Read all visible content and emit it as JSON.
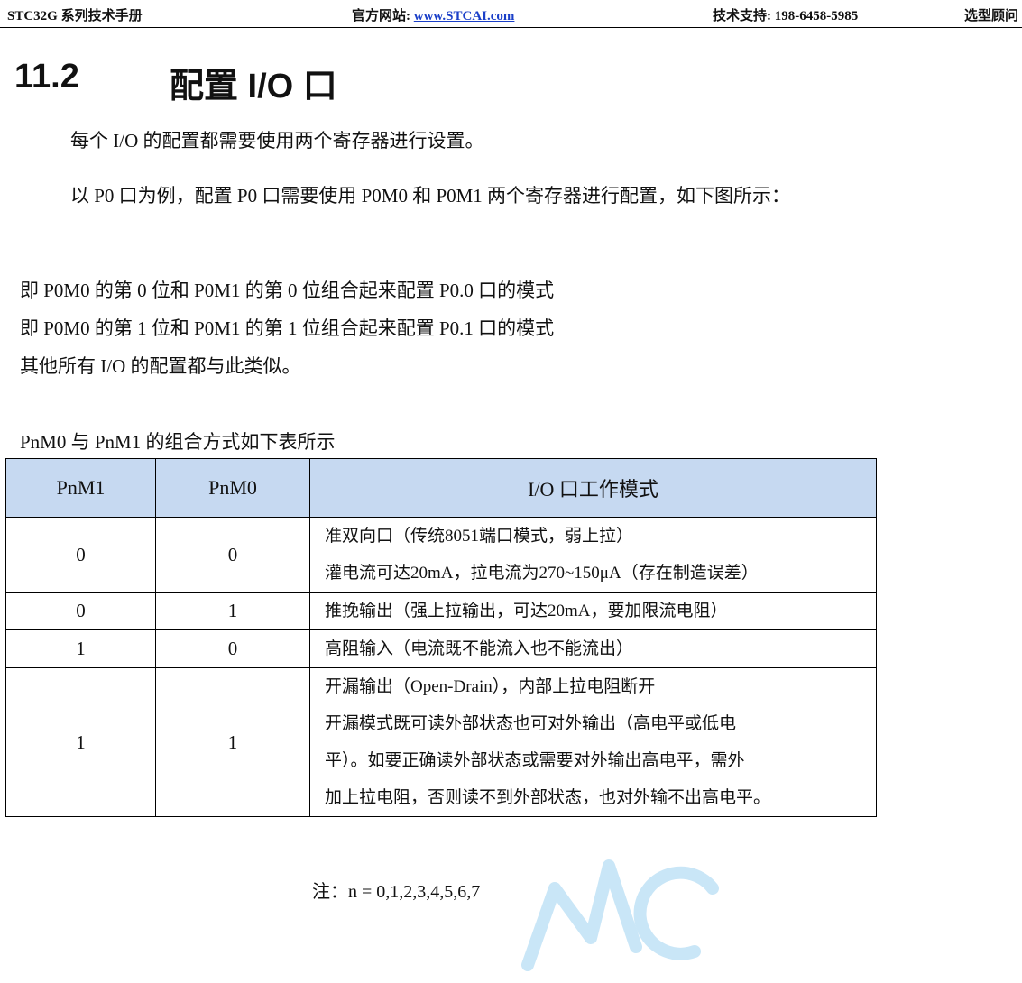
{
  "header": {
    "manual": "STC32G 系列技术手册",
    "site_label": "官方网站: ",
    "site_url": "www.STCAI.com",
    "support": "技术支持: 198-6458-5985",
    "selection": "选型顾问"
  },
  "section": {
    "number": "11.2",
    "title": "配置 I/O 口"
  },
  "paragraphs": {
    "p1": "每个 I/O 的配置都需要使用两个寄存器进行设置。",
    "p2": "以 P0 口为例，配置 P0 口需要使用 P0M0 和 P0M1 两个寄存器进行配置，如下图所示：",
    "p3": "即 P0M0 的第 0 位和 P0M1 的第 0 位组合起来配置 P0.0 口的模式",
    "p4": "即 P0M0 的第 1 位和 P0M1 的第 1 位组合起来配置 P0.1 口的模式",
    "p5": "其他所有 I/O 的配置都与此类似。"
  },
  "table": {
    "caption": "PnM0 与 PnM1 的组合方式如下表所示",
    "headers": [
      "PnM1",
      "PnM0",
      "I/O 口工作模式"
    ],
    "rows": [
      {
        "m1": "0",
        "m0": "0",
        "lines": [
          "准双向口（传统8051端口模式，弱上拉）",
          "灌电流可达20mA，拉电流为270~150μA（存在制造误差）"
        ]
      },
      {
        "m1": "0",
        "m0": "1",
        "lines": [
          "推挽输出（强上拉输出，可达20mA，要加限流电阻）"
        ]
      },
      {
        "m1": "1",
        "m0": "0",
        "lines": [
          "高阻输入（电流既不能流入也不能流出）"
        ]
      },
      {
        "m1": "1",
        "m0": "1",
        "lines": [
          "开漏输出（Open-Drain），内部上拉电阻断开",
          "开漏模式既可读外部状态也可对外输出（高电平或低电",
          "平）。如要正确读外部状态或需要对外输出高电平，需外",
          "加上拉电阻，否则读不到外部状态，也对外输不出高电平。"
        ]
      }
    ]
  },
  "note": "注：n = 0,1,2,3,4,5,6,7",
  "colors": {
    "header_fill": "#c6d9f1",
    "link": "#1a3fc8",
    "watermark": "#c9e6f7"
  }
}
